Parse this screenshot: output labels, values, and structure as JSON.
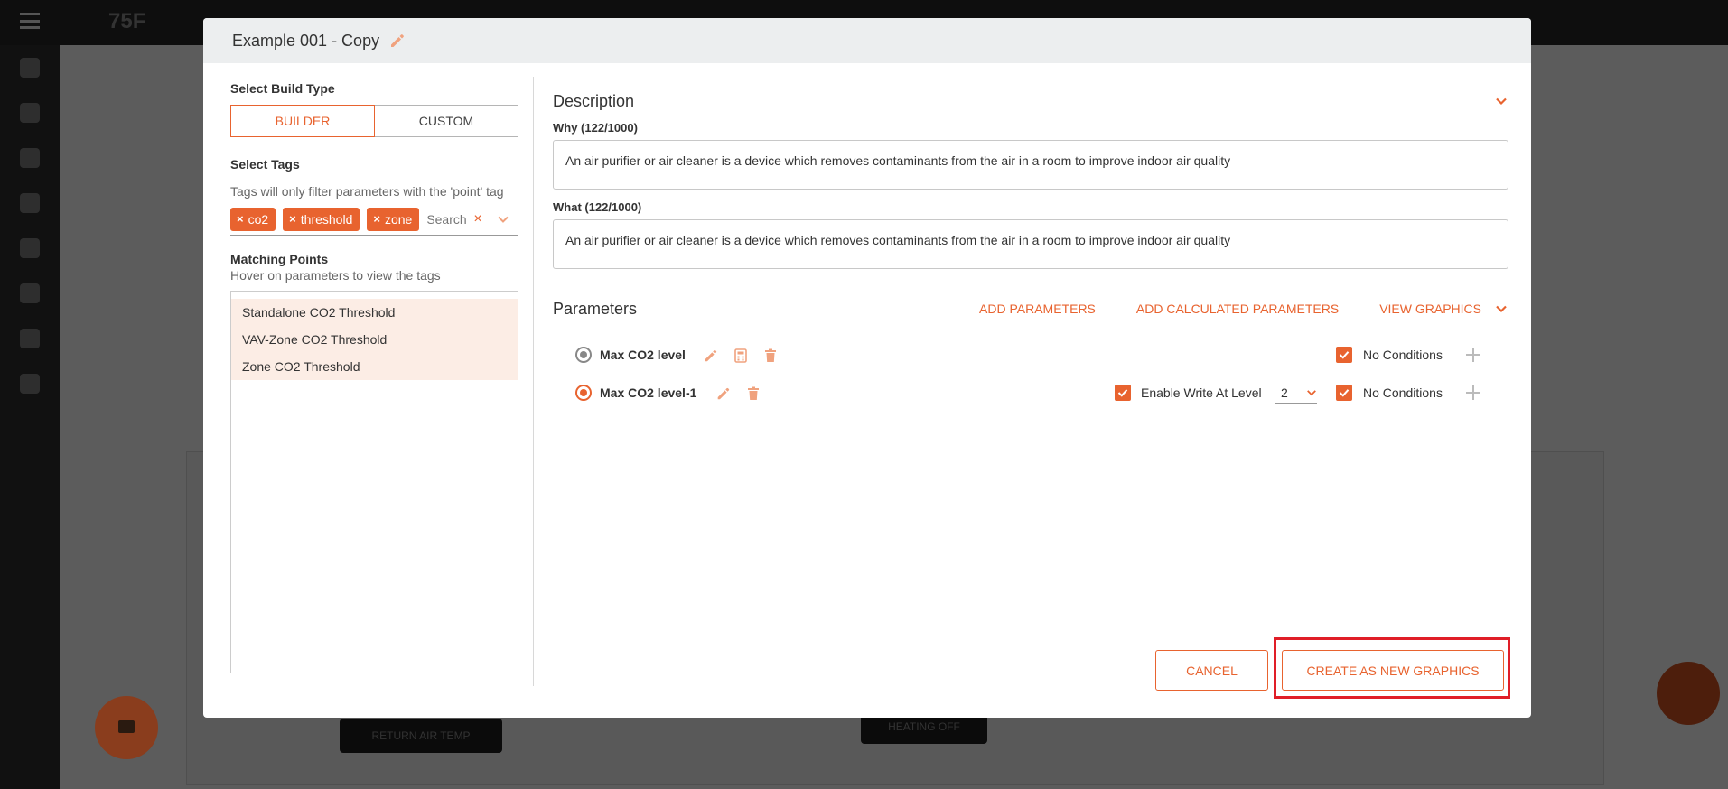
{
  "modal": {
    "title": "Example 001 - Copy",
    "select_build_type_label": "Select Build Type",
    "build_types": [
      {
        "label": "BUILDER",
        "active": true
      },
      {
        "label": "CUSTOM",
        "active": false
      }
    ],
    "select_tags_label": "Select Tags",
    "tags_hint": "Tags will only filter parameters with the 'point' tag",
    "tags": [
      "co2",
      "threshold",
      "zone"
    ],
    "tags_search_placeholder": "Search",
    "matching_points_label": "Matching Points",
    "matching_points_hint": "Hover on parameters to view the tags",
    "matching_points": [
      "Standalone CO2 Threshold",
      "VAV-Zone CO2 Threshold",
      "Zone CO2 Threshold"
    ],
    "description": {
      "title": "Description",
      "why_label": "Why (122/1000)",
      "why_text": "An air purifier or air cleaner is a device which removes contaminants from the air in a room to improve indoor air quality",
      "what_label": "What (122/1000)",
      "what_text": "An air purifier or air cleaner is a device which removes contaminants from the air in a room to improve indoor air quality"
    },
    "parameters": {
      "title": "Parameters",
      "actions": [
        "ADD PARAMETERS",
        "ADD CALCULATED PARAMETERS",
        "VIEW GRAPHICS"
      ],
      "rows": [
        {
          "name": "Max CO2 level",
          "selected": false,
          "conditions_label": "No Conditions"
        },
        {
          "name": "Max CO2 level-1",
          "selected": true,
          "enable_write_label": "Enable Write At Level",
          "write_level": "2",
          "conditions_label": "No Conditions"
        }
      ]
    },
    "footer": {
      "cancel_label": "CANCEL",
      "create_label": "CREATE AS NEW GRAPHICS"
    }
  },
  "background": {
    "logo": "75F",
    "pill_1": "RETURN AIR TEMP",
    "pill_2": "HEATING OFF"
  },
  "colors": {
    "accent": "#e8632f",
    "highlight": "#e01e28"
  }
}
